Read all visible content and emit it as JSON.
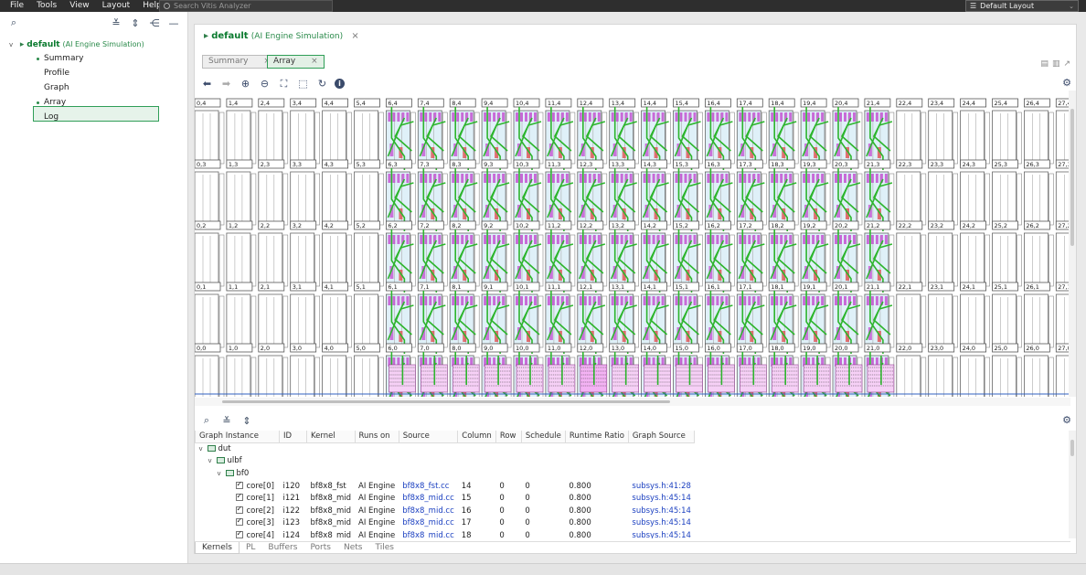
{
  "menu": [
    "File",
    "Tools",
    "View",
    "Layout",
    "Help"
  ],
  "search": {
    "placeholder": "Search Vitis Analyzer"
  },
  "layout": {
    "selected": "Default Layout"
  },
  "tree": {
    "root_label": "default",
    "root_sub": "(AI Engine Simulation)",
    "items": [
      "Summary",
      "Profile",
      "Graph",
      "Array",
      "Log"
    ],
    "selected": "Array"
  },
  "main": {
    "title": "default",
    "title_sub": "(AI Engine Simulation)",
    "close": "×",
    "tabs": [
      {
        "label": "Summary",
        "close": "×"
      },
      {
        "label": "Array",
        "close": "×"
      }
    ]
  },
  "array": {
    "columns": 28,
    "tile_rows": [
      4,
      3,
      2,
      1,
      0
    ],
    "active_col_start": 6,
    "active_col_end": 21
  },
  "kernels": {
    "headers": [
      "Graph Instance",
      "ID",
      "Kernel",
      "Runs on",
      "Source",
      "Column",
      "Row",
      "Schedule",
      "Runtime Ratio",
      "Graph Source"
    ],
    "tree": [
      {
        "label": "dut",
        "level": 0
      },
      {
        "label": "ulbf",
        "level": 1
      },
      {
        "label": "bf0",
        "level": 2
      }
    ],
    "rows": [
      {
        "instance": "core[0]",
        "id": "i120",
        "kernel": "bf8x8_fst",
        "runs_on": "AI Engine",
        "source": "bf8x8_fst.cc",
        "column": "14",
        "row": "0",
        "schedule": "0",
        "ratio": "0.800",
        "graph_source": "subsys.h:41:28"
      },
      {
        "instance": "core[1]",
        "id": "i121",
        "kernel": "bf8x8_mid",
        "runs_on": "AI Engine",
        "source": "bf8x8_mid.cc",
        "column": "15",
        "row": "0",
        "schedule": "0",
        "ratio": "0.800",
        "graph_source": "subsys.h:45:14"
      },
      {
        "instance": "core[2]",
        "id": "i122",
        "kernel": "bf8x8_mid",
        "runs_on": "AI Engine",
        "source": "bf8x8_mid.cc",
        "column": "16",
        "row": "0",
        "schedule": "0",
        "ratio": "0.800",
        "graph_source": "subsys.h:45:14"
      },
      {
        "instance": "core[3]",
        "id": "i123",
        "kernel": "bf8x8_mid",
        "runs_on": "AI Engine",
        "source": "bf8x8_mid.cc",
        "column": "17",
        "row": "0",
        "schedule": "0",
        "ratio": "0.800",
        "graph_source": "subsys.h:45:14"
      },
      {
        "instance": "core[4]",
        "id": "i124",
        "kernel": "bf8x8_mid",
        "runs_on": "AI Engine",
        "source": "bf8x8_mid.cc",
        "column": "18",
        "row": "0",
        "schedule": "0",
        "ratio": "0.800",
        "graph_source": "subsys.h:45:14"
      }
    ]
  },
  "bottom_tabs": [
    "Kernels",
    "PL",
    "Buffers",
    "Ports",
    "Nets",
    "Tiles"
  ],
  "colors": {
    "accent_green": "#2f9e57",
    "route_green": "#2db52d",
    "buffer_magenta": "#c24ad0",
    "link_blue": "#1a3fc0"
  }
}
